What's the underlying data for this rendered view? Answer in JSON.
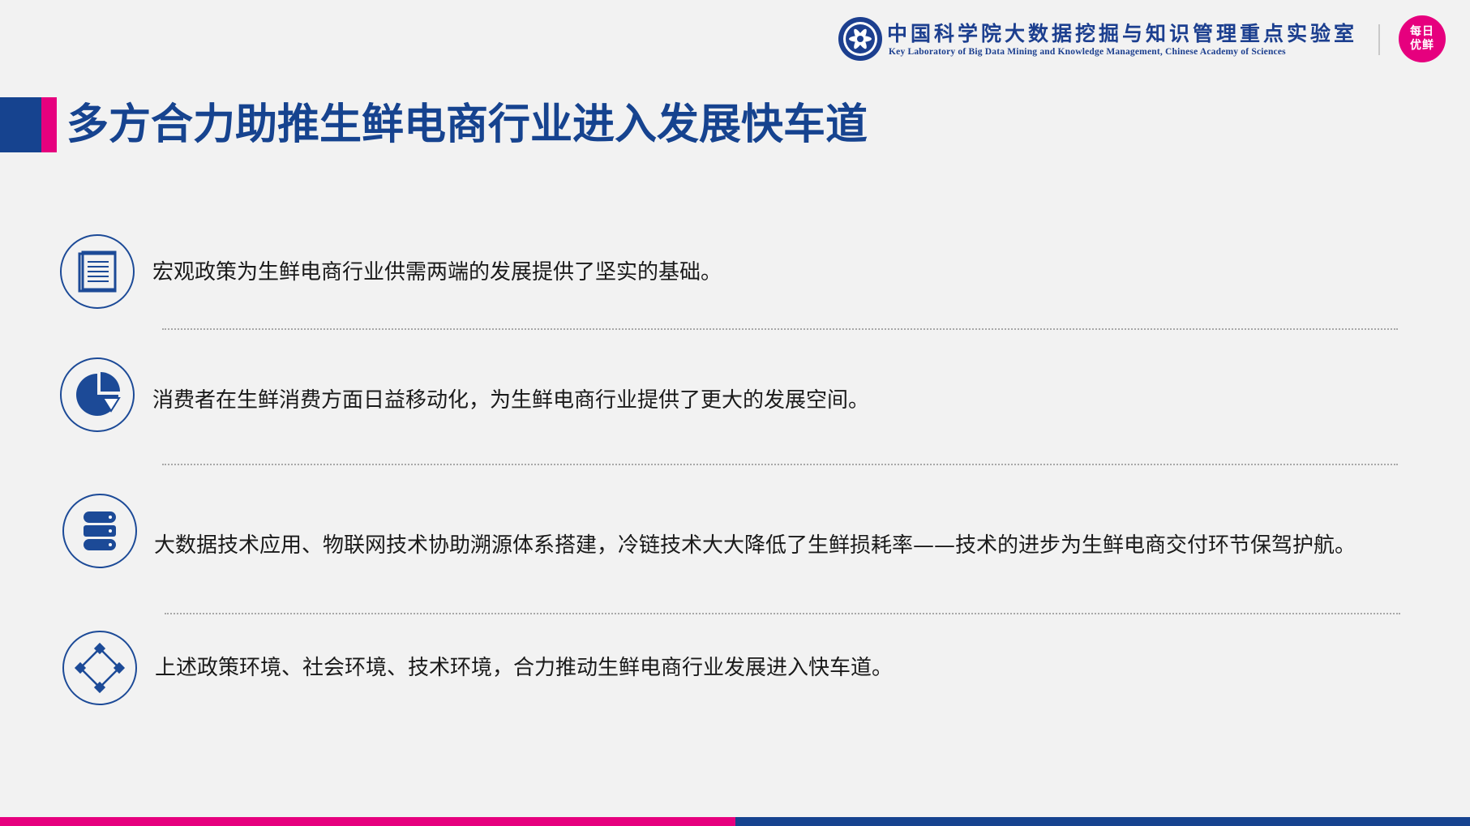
{
  "header": {
    "lab_name_cn": "中国科学院大数据挖掘与知识管理重点实验室",
    "lab_name_en": "Key Laboratory of Big Data Mining and Knowledge Management, Chinese Academy of Sciences",
    "brand_badge_line1": "每日",
    "brand_badge_line2": "优鲜",
    "logo_icon": "cas-emblem-icon"
  },
  "title": "多方合力助推生鲜电商行业进入发展快车道",
  "points": [
    {
      "icon": "document-icon",
      "text": "宏观政策为生鲜电商行业供需两端的发展提供了坚实的基础。"
    },
    {
      "icon": "pie-chart-icon",
      "text": "消费者在生鲜消费方面日益移动化，为生鲜电商行业提供了更大的发展空间。"
    },
    {
      "icon": "database-icon",
      "text": "大数据技术应用、物联网技术协助溯源体系搭建，冷链技术大大降低了生鲜损耗率——技术的进步为生鲜电商交付环节保驾护航。"
    },
    {
      "icon": "diamond-network-icon",
      "text": "上述政策环境、社会环境、技术环境，合力推动生鲜电商行业发展进入快车道。"
    }
  ],
  "colors": {
    "brand_blue": "#16438f",
    "brand_pink": "#e6007e",
    "background": "#f2f2f2",
    "text": "#1a1a1a"
  }
}
